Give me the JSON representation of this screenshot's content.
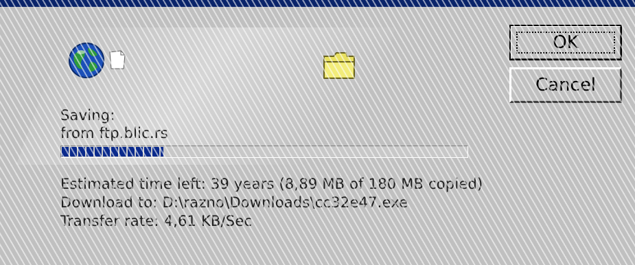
{
  "window": {
    "titlebar_color": "#0a246a",
    "background": "#c0c0c0"
  },
  "icons": {
    "source": "globe-icon",
    "document": "page-icon",
    "destination": "folder-icon"
  },
  "buttons": {
    "ok_label": "OK",
    "cancel_label": "Cancel"
  },
  "status": {
    "action": "Saving:",
    "source": "from ftp.blic.rs"
  },
  "progress": {
    "fraction": 0.25,
    "color": "#0a2a8c"
  },
  "details": {
    "estimated_time": "Estimated time left: 39 years (8,89 MB of 180 MB copied)",
    "download_to": "Download to: D:\\razno\\Downloads\\cc32e47.exe",
    "transfer_rate": "Transfer rate: 4,61 KB/Sec"
  }
}
